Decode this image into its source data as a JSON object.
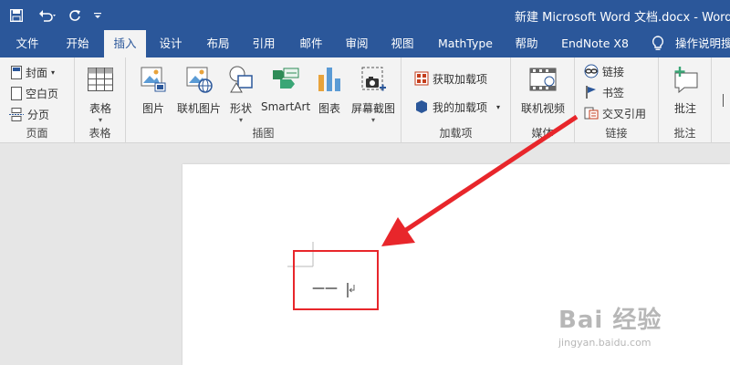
{
  "window": {
    "title": "新建 Microsoft Word 文档.docx  -  Word"
  },
  "tabs": [
    "文件",
    "开始",
    "插入",
    "设计",
    "布局",
    "引用",
    "邮件",
    "审阅",
    "视图",
    "MathType",
    "帮助",
    "EndNote X8"
  ],
  "tell_me": "操作说明搜",
  "ribbon": {
    "pages": {
      "label": "页面",
      "cover": "封面",
      "blank": "空白页",
      "break": "分页"
    },
    "tables": {
      "label": "表格",
      "table": "表格"
    },
    "illustrations": {
      "label": "插图",
      "picture": "图片",
      "online_picture": "联机图片",
      "shapes": "形状",
      "smartart": "SmartArt",
      "chart": "图表",
      "screenshot": "屏幕截图"
    },
    "addins": {
      "label": "加载项",
      "get": "获取加载项",
      "my": "我的加载项"
    },
    "media": {
      "label": "媒体",
      "online_video": "联机视频"
    },
    "links": {
      "label": "链接",
      "link": "链接",
      "bookmark": "书签",
      "crossref": "交叉引用"
    },
    "comments": {
      "label": "批注",
      "comment": "批注"
    }
  },
  "document": {
    "text": "——"
  },
  "watermark": {
    "main": "Bai 经验",
    "sub": "jingyan.baidu.com"
  },
  "colors": {
    "titlebar": "#2b579a",
    "ribbon": "#f3f3f3",
    "annotation": "#e8262b"
  }
}
